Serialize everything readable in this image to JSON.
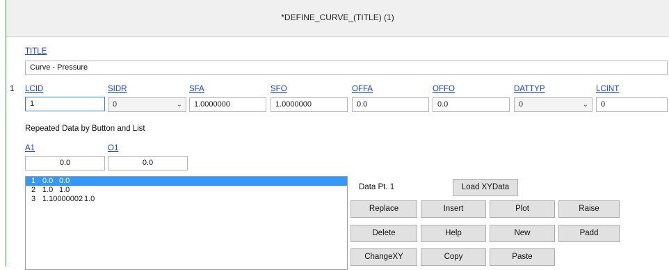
{
  "header": {
    "title": "*DEFINE_CURVE_(TITLE)  (1)"
  },
  "title_section": {
    "label": "TITLE",
    "value": "Curve - Pressure"
  },
  "card1": {
    "row_number": "1",
    "fields": [
      {
        "label": "LCID",
        "value": "1"
      },
      {
        "label": "SIDR",
        "value": "0"
      },
      {
        "label": "SFA",
        "value": "1.0000000"
      },
      {
        "label": "SFO",
        "value": "1.0000000"
      },
      {
        "label": "OFFA",
        "value": "0.0"
      },
      {
        "label": "OFFO",
        "value": "0.0"
      },
      {
        "label": "DATTYP",
        "value": "0"
      },
      {
        "label": "LCINT",
        "value": "0"
      }
    ]
  },
  "repeated": {
    "heading": "Repeated Data by Button and List",
    "a1": {
      "label": "A1",
      "value": "0.0"
    },
    "o1": {
      "label": "O1",
      "value": "0.0"
    },
    "rows": [
      {
        "index": "1",
        "a": "0.0",
        "o": "0.0",
        "selected": true
      },
      {
        "index": "2",
        "a": "1.0",
        "o": "1.0",
        "selected": false
      },
      {
        "index": "3",
        "a": "1.10000002",
        "o": "1.0",
        "selected": false
      }
    ]
  },
  "buttons": {
    "data_pt": "Data Pt.  1",
    "load_xydata": "Load XYData",
    "replace": "Replace",
    "insert": "Insert",
    "plot": "Plot",
    "raise": "Raise",
    "delete": "Delete",
    "help": "Help",
    "new": "New",
    "padd": "Padd",
    "changexy": "ChangeXY",
    "copy": "Copy",
    "paste": "Paste"
  },
  "colors": {
    "accent_link": "#1a3fbf",
    "selection": "#3399ff",
    "left_border": "#2e9b3c"
  }
}
